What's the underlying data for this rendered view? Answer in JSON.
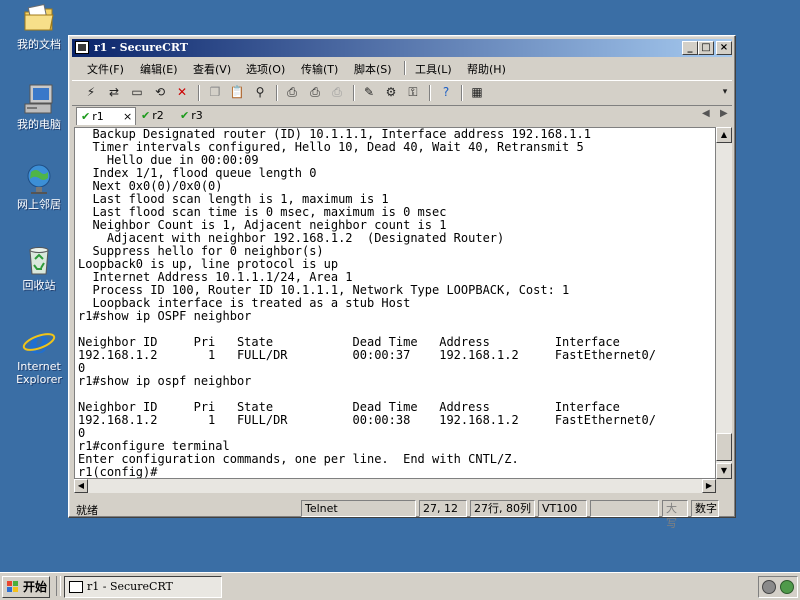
{
  "desktop": {
    "icons": [
      {
        "label": "我的文档"
      },
      {
        "label": "我的电脑"
      },
      {
        "label": "网上邻居"
      },
      {
        "label": "回收站"
      },
      {
        "label": "Internet Explorer"
      }
    ]
  },
  "window": {
    "title": "r1 - SecureCRT",
    "controls": {
      "minimize": "_",
      "maximize": "□",
      "close": "×"
    }
  },
  "menu": {
    "items": [
      "文件(F)",
      "编辑(E)",
      "查看(V)",
      "选项(O)",
      "传输(T)",
      "脚本(S)",
      "工具(L)",
      "帮助(H)"
    ]
  },
  "toolbar": {
    "icons": [
      "connect-icon",
      "quick-connect-icon",
      "connect-tab-icon",
      "reconnect-icon",
      "disconnect-icon",
      "copy-icon",
      "paste-icon",
      "find-icon",
      "print-icon",
      "print-selection-icon",
      "print-setup-icon",
      "session-options-icon",
      "global-options-icon",
      "keymap-icon",
      "help-icon",
      "tile-icon"
    ]
  },
  "tabs": [
    {
      "label": "r1",
      "close": "×",
      "active": true
    },
    {
      "label": "r2",
      "active": false
    },
    {
      "label": "r3",
      "active": false
    }
  ],
  "terminal": {
    "lines": [
      "  Backup Designated router (ID) 10.1.1.1, Interface address 192.168.1.1",
      "  Timer intervals configured, Hello 10, Dead 40, Wait 40, Retransmit 5",
      "    Hello due in 00:00:09",
      "  Index 1/1, flood queue length 0",
      "  Next 0x0(0)/0x0(0)",
      "  Last flood scan length is 1, maximum is 1",
      "  Last flood scan time is 0 msec, maximum is 0 msec",
      "  Neighbor Count is 1, Adjacent neighbor count is 1",
      "    Adjacent with neighbor 192.168.1.2  (Designated Router)",
      "  Suppress hello for 0 neighbor(s)",
      "Loopback0 is up, line protocol is up",
      "  Internet Address 10.1.1.1/24, Area 1",
      "  Process ID 100, Router ID 10.1.1.1, Network Type LOOPBACK, Cost: 1",
      "  Loopback interface is treated as a stub Host",
      "r1#show ip OSPF neighbor",
      "",
      "Neighbor ID     Pri   State           Dead Time   Address         Interface",
      "192.168.1.2       1   FULL/DR         00:00:37    192.168.1.2     FastEthernet0/",
      "0",
      "r1#show ip ospf neighbor",
      "",
      "Neighbor ID     Pri   State           Dead Time   Address         Interface",
      "192.168.1.2       1   FULL/DR         00:00:38    192.168.1.2     FastEthernet0/",
      "0",
      "r1#configure terminal",
      "Enter configuration commands, one per line.  End with CNTL/Z.",
      "r1(config)#"
    ]
  },
  "status": {
    "ready": "就绪",
    "protocol": "Telnet",
    "cursor": "27, 12",
    "size": "27行, 80列",
    "emulation": "VT100",
    "empty": "",
    "caps": "大写",
    "num": "数字"
  },
  "taskbar": {
    "start_label": "开始",
    "task_label": "r1 - SecureCRT"
  }
}
